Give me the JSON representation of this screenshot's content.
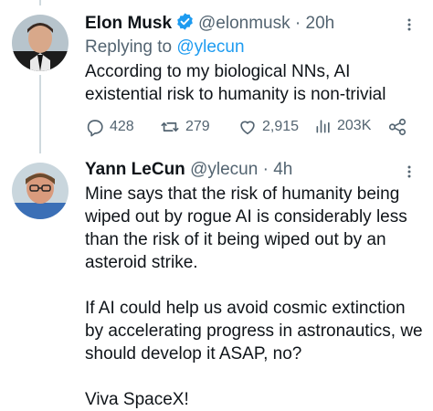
{
  "tweets": [
    {
      "name": "Elon Musk",
      "handle": "@elonmusk",
      "separator": "·",
      "time": "20h",
      "replying_prefix": "Replying to",
      "replying_handle": "@ylecun",
      "text": "According to my biological NNs, AI\nexistential risk to humanity is non-trivial",
      "actions": {
        "replies": "428",
        "retweets": "279",
        "likes": "2,915",
        "views": "203K"
      }
    },
    {
      "name": "Yann LeCun",
      "handle": "@ylecun",
      "separator": "·",
      "time": "4h",
      "text": "Mine says that the risk of humanity being\nwiped out by rogue AI is considerably less\nthan the risk of it being wiped out by an\nasteroid strike.\n\nIf AI could help us avoid cosmic extinction\nby accelerating progress in astronautics, we\nshould develop it ASAP, no?\n\nViva SpaceX!"
    }
  ],
  "colors": {
    "text": "#0f1419",
    "secondary": "#536471",
    "accent": "#1d9bf0",
    "thread_line": "#cfd9de"
  },
  "icons": [
    "verified-badge-icon",
    "more-icon",
    "reply-icon",
    "retweet-icon",
    "like-icon",
    "views-icon",
    "share-icon"
  ]
}
